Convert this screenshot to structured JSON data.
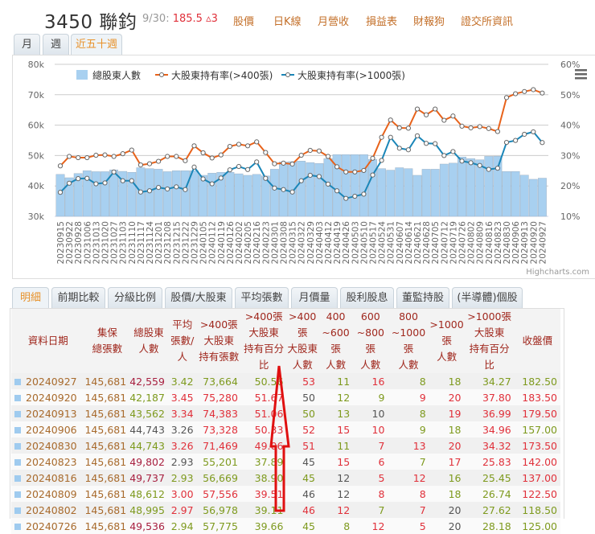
{
  "header": {
    "stock": "3450 聯鈞",
    "date": "9/30:",
    "price": "185.5",
    "change": "▵3",
    "links": [
      "股價",
      "日K線",
      "月營收",
      "損益表",
      "財報狗",
      "證交所資訊"
    ]
  },
  "period_tabs": [
    "月",
    "週",
    "近五十週"
  ],
  "chart_data": {
    "type": "bar+line",
    "legend": [
      "總股東人數",
      "大股東持有率(>400張)",
      "大股東持有率(>1000張)"
    ],
    "legend_placement": "top",
    "credit": "Highcharts.com",
    "left_axis": {
      "ticks": [
        "30k",
        "40k",
        "50k",
        "60k",
        "70k",
        "80k"
      ],
      "range": [
        30000,
        80000
      ]
    },
    "right_axis": {
      "ticks": [
        "10%",
        "20%",
        "30%",
        "40%",
        "50%",
        "60%"
      ],
      "range": [
        10,
        60
      ]
    },
    "categories": [
      "20230915",
      "20230922",
      "20230928",
      "20231006",
      "20231013",
      "20231020",
      "20231027",
      "20231103",
      "20231110",
      "20231117",
      "20231124",
      "20231201",
      "20231208",
      "20231215",
      "20231222",
      "20231229",
      "20240105",
      "20240112",
      "20240119",
      "20240126",
      "20240202",
      "20240205",
      "20240216",
      "20240223",
      "20240301",
      "20240308",
      "20240315",
      "20240322",
      "20240329",
      "20240403",
      "20240412",
      "20240419",
      "20240426",
      "20240503",
      "20240510",
      "20240517",
      "20240524",
      "20240531",
      "20240607",
      "20240614",
      "20240621",
      "20240628",
      "20240705",
      "20240712",
      "20240719",
      "20240726",
      "20240802",
      "20240809",
      "20240816",
      "20240823",
      "20240830",
      "20240906",
      "20240913",
      "20240920",
      "20240927"
    ],
    "series": [
      {
        "name": "總股東人數",
        "type": "bar",
        "color": "#a8d0f0",
        "values": [
          43800,
          42700,
          44100,
          45000,
          44700,
          44700,
          45300,
          44800,
          44500,
          46000,
          45700,
          45500,
          44700,
          45000,
          45000,
          45000,
          43500,
          44200,
          44500,
          44500,
          44000,
          43500,
          43800,
          43300,
          45500,
          47900,
          48000,
          48200,
          47700,
          47400,
          49000,
          50300,
          50300,
          50300,
          50300,
          48700,
          45700,
          45200,
          46000,
          45700,
          43500,
          45500,
          45500,
          47200,
          47500,
          49536,
          48995,
          48612,
          49737,
          49802,
          44743,
          44743,
          43562,
          42187,
          42559
        ]
      },
      {
        "name": "大股東持有率(>400張)",
        "type": "line",
        "color": "#e8621a",
        "values": [
          26.6,
          29.7,
          29.3,
          29.3,
          30.1,
          30.2,
          29.7,
          30.6,
          31.8,
          26.9,
          27.3,
          28.1,
          29.7,
          29.7,
          28.3,
          33.2,
          30.9,
          29.2,
          30.2,
          33.0,
          33.7,
          33.2,
          34.5,
          31.0,
          27.3,
          27.5,
          27.2,
          30.1,
          31.7,
          31.5,
          29.7,
          26.3,
          24.6,
          24.6,
          25.1,
          29.1,
          36.0,
          41.7,
          39.1,
          39.0,
          45.3,
          43.4,
          45.3,
          41.6,
          43.0,
          39.66,
          39.11,
          39.51,
          38.9,
          37.89,
          49.06,
          50.33,
          51.06,
          51.67,
          50.56
        ]
      },
      {
        "name": "大股東持有率(>1000張)",
        "type": "line",
        "color": "#1a86b8",
        "values": [
          17.9,
          20.9,
          22.4,
          22.5,
          20.7,
          21.0,
          24.6,
          21.7,
          21.7,
          18.0,
          18.4,
          19.5,
          19.0,
          19.7,
          18.8,
          26.2,
          22.3,
          20.7,
          22.6,
          25.3,
          26.4,
          25.4,
          27.9,
          22.5,
          19.3,
          18.8,
          18.0,
          21.7,
          23.5,
          23.1,
          20.6,
          18.4,
          15.9,
          16.6,
          17.3,
          23.6,
          28.4,
          36.0,
          32.4,
          31.9,
          36.5,
          34.0,
          33.9,
          30.0,
          31.3,
          28.18,
          27.62,
          26.74,
          25.45,
          25.83,
          34.32,
          34.96,
          36.99,
          37.8,
          34.27
        ]
      }
    ]
  },
  "detail_tabs": [
    "明細",
    "前期比較",
    "分級比例",
    "股價/大股東",
    "平均張數",
    "月價量",
    "股利股息",
    "董監持股",
    "(半導體)個股"
  ],
  "table": {
    "headers": [
      [
        "資料日期"
      ],
      [
        "集保",
        "總張數"
      ],
      [
        "總股東",
        "人數"
      ],
      [
        "平均",
        "張數/人"
      ],
      [
        ">400張",
        "大股東",
        "持有張數"
      ],
      [
        ">400張",
        "大股東",
        "持有百分比"
      ],
      [
        ">400張",
        "大股東",
        "人數"
      ],
      [
        "400",
        "~600張",
        "人數"
      ],
      [
        "600",
        "~800張",
        "人數"
      ],
      [
        "800",
        "~1000張",
        "人數"
      ],
      [
        ">1000張",
        "人數"
      ],
      [
        ">1000張",
        "大股東",
        "持有百分比"
      ],
      [
        "收盤價"
      ]
    ],
    "rows": [
      {
        "cells": [
          "20240927",
          "145,681",
          "42,559",
          "3.42",
          "73,664",
          "50.56",
          "53",
          "11",
          "16",
          "8",
          "18",
          "34.27",
          "182.50"
        ],
        "colors": "b b dr g g g r g r g g g g"
      },
      {
        "cells": [
          "20240920",
          "145,681",
          "42,187",
          "3.45",
          "75,280",
          "51.67",
          "50",
          "12",
          "9",
          "9",
          "20",
          "37.80",
          "183.50"
        ],
        "colors": "b b g r r r k g g r r r r"
      },
      {
        "cells": [
          "20240913",
          "145,681",
          "43,562",
          "3.34",
          "74,383",
          "51.06",
          "50",
          "13",
          "10",
          "8",
          "19",
          "36.99",
          "179.50"
        ],
        "colors": "b b g r r r g g k g r r r"
      },
      {
        "cells": [
          "20240906",
          "145,681",
          "44,743",
          "3.26",
          "73,328",
          "50.33",
          "52",
          "15",
          "10",
          "9",
          "18",
          "34.96",
          "157.00"
        ],
        "colors": "b b k k r r r r r g g r g"
      },
      {
        "cells": [
          "20240830",
          "145,681",
          "44,743",
          "3.26",
          "71,469",
          "49.06",
          "51",
          "11",
          "7",
          "13",
          "20",
          "34.32",
          "173.50"
        ],
        "colors": "b b g r r r r g r r r r r"
      },
      {
        "cells": [
          "20240823",
          "145,681",
          "49,802",
          "2.93",
          "55,201",
          "37.89",
          "45",
          "15",
          "6",
          "7",
          "17",
          "25.83",
          "142.00"
        ],
        "colors": "b b dr k g g k r r g r r r"
      },
      {
        "cells": [
          "20240816",
          "145,681",
          "49,737",
          "2.93",
          "56,669",
          "38.90",
          "45",
          "12",
          "5",
          "12",
          "16",
          "25.45",
          "137.00"
        ],
        "colors": "b b dr g g g g k r r g g r"
      },
      {
        "cells": [
          "20240809",
          "145,681",
          "48,612",
          "3.00",
          "57,556",
          "39.51",
          "46",
          "12",
          "8",
          "8",
          "18",
          "26.74",
          "122.50"
        ],
        "colors": "b b g r r r k k r r g g r"
      },
      {
        "cells": [
          "20240802",
          "145,681",
          "48,995",
          "2.97",
          "56,978",
          "39.11",
          "46",
          "12",
          "7",
          "7",
          "20",
          "27.62",
          "118.50"
        ],
        "colors": "b b g r g g r r g r k g g"
      },
      {
        "cells": [
          "20240726",
          "145,681",
          "49,536",
          "2.94",
          "57,775",
          "39.66",
          "45",
          "8",
          "12",
          "5",
          "20",
          "28.18",
          "125.00"
        ],
        "colors": "b b dr g g g g g r r k g g"
      }
    ]
  }
}
